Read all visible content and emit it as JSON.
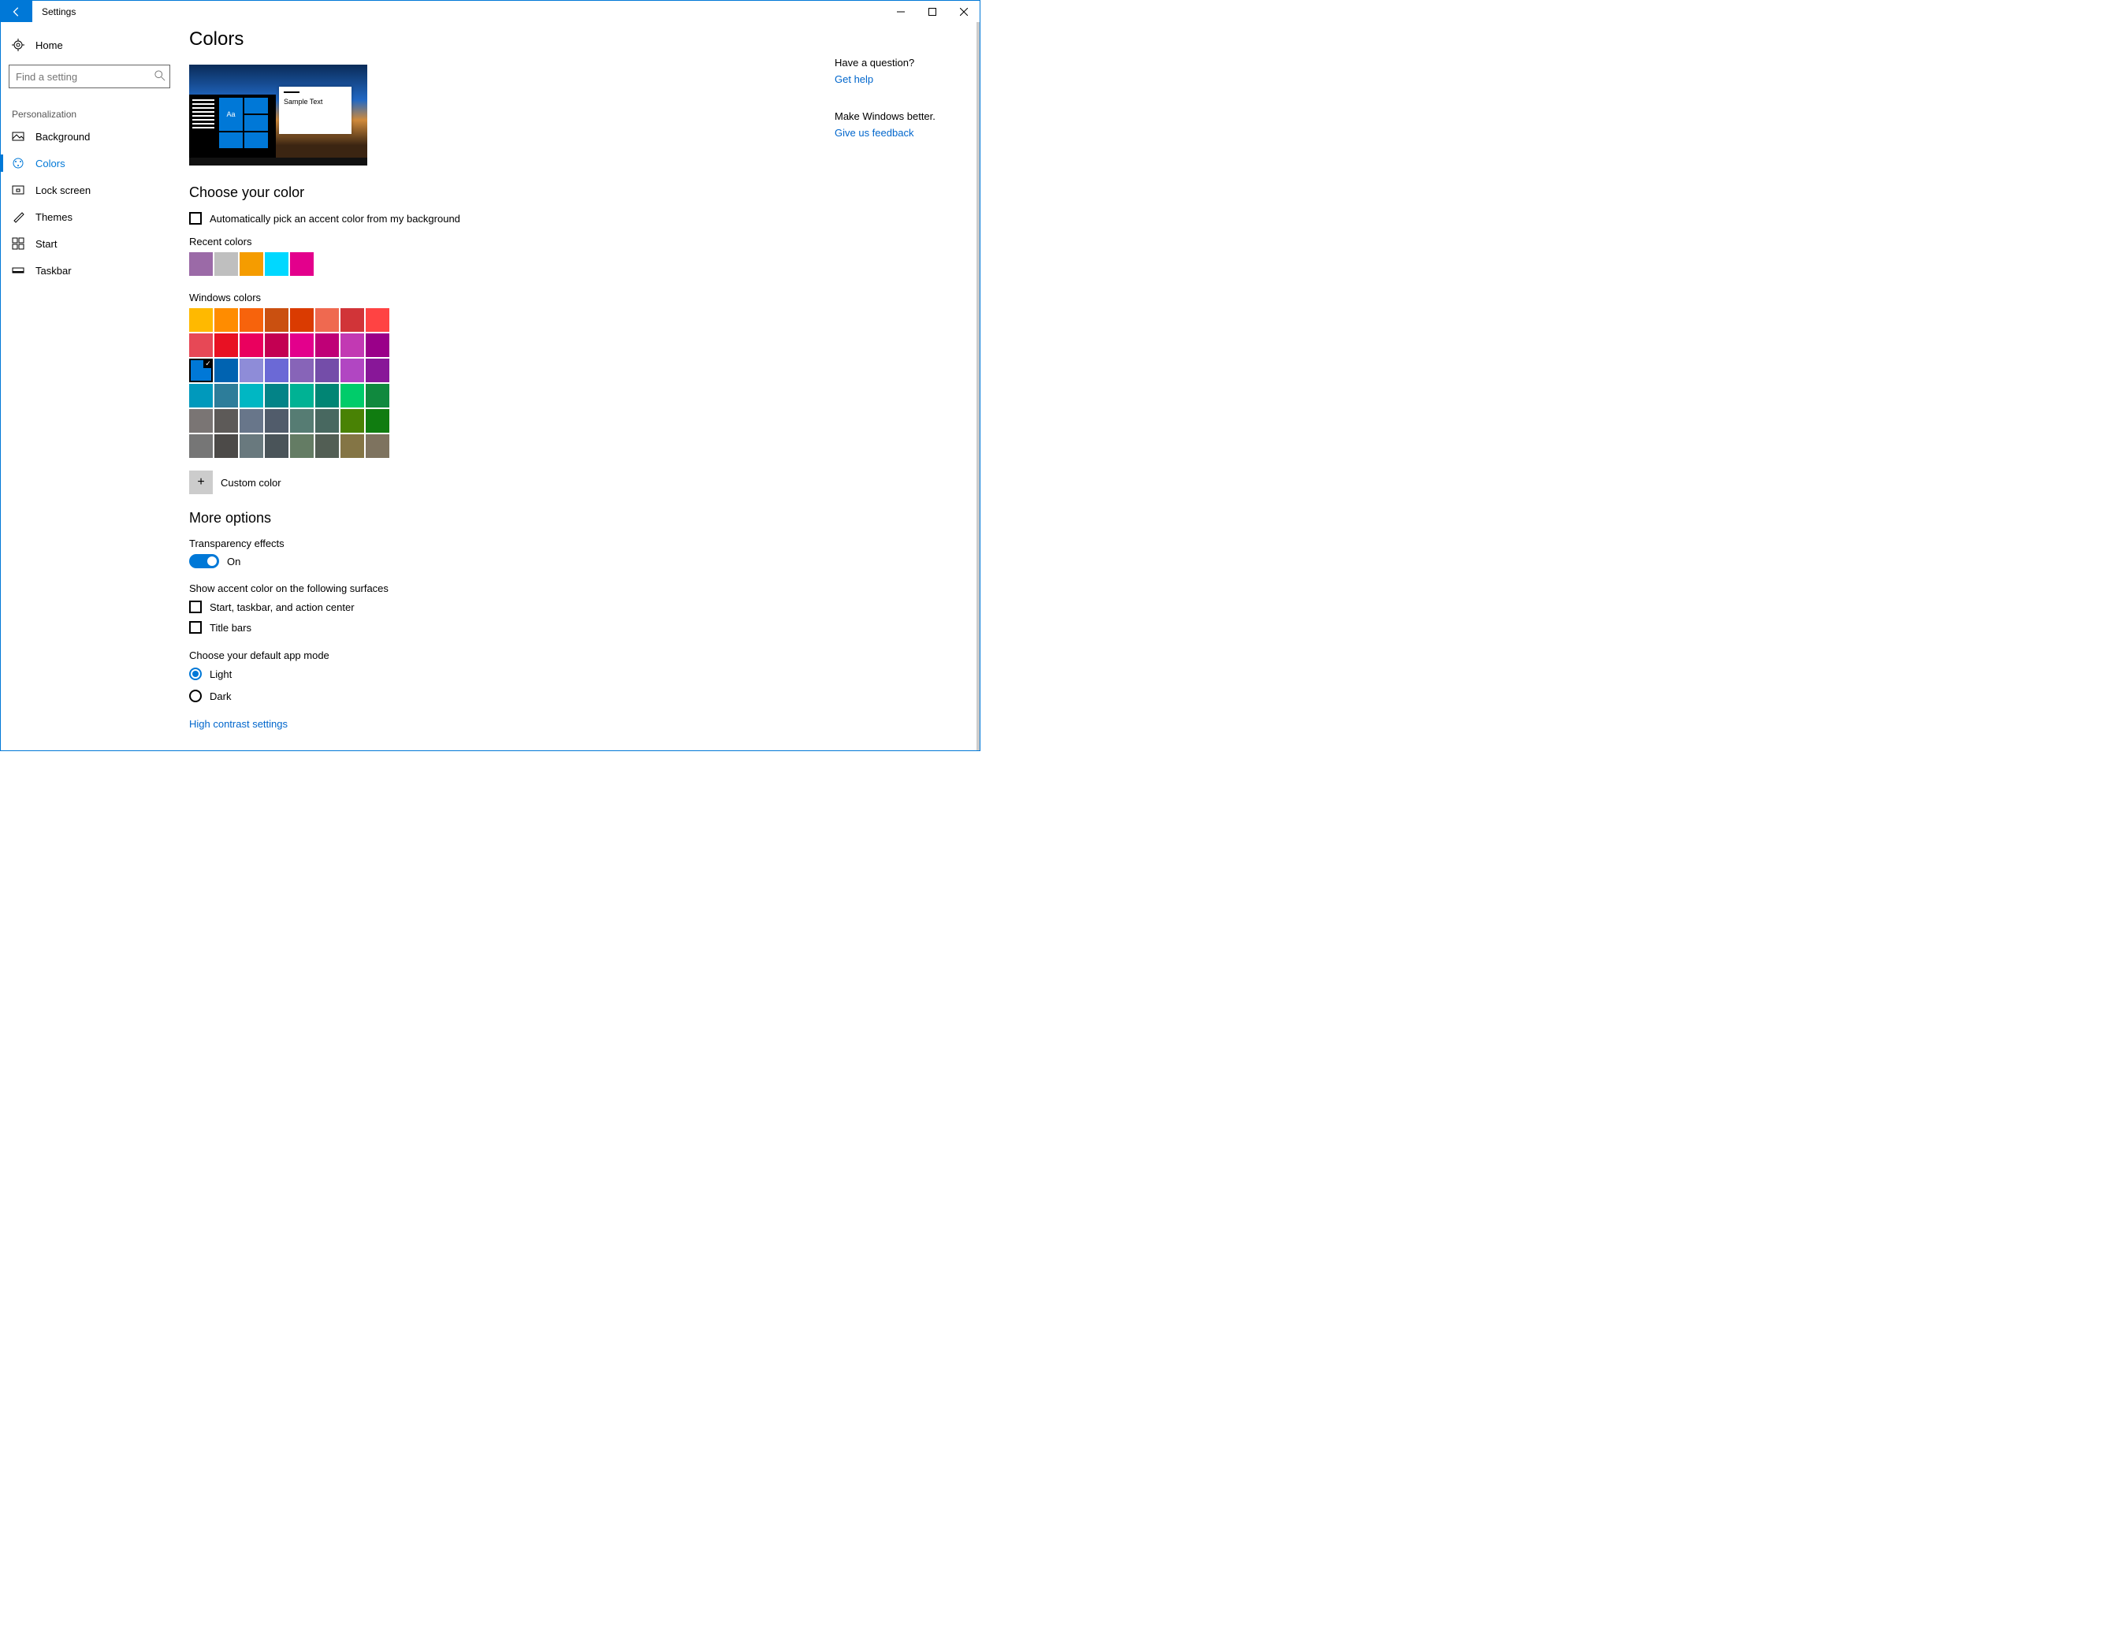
{
  "window": {
    "title": "Settings"
  },
  "sidebar": {
    "home": "Home",
    "search_placeholder": "Find a setting",
    "section": "Personalization",
    "items": [
      {
        "label": "Background"
      },
      {
        "label": "Colors"
      },
      {
        "label": "Lock screen"
      },
      {
        "label": "Themes"
      },
      {
        "label": "Start"
      },
      {
        "label": "Taskbar"
      }
    ]
  },
  "page": {
    "title": "Colors",
    "preview_sample_text": "Sample Text",
    "preview_aa": "Aa",
    "choose_color_heading": "Choose your color",
    "auto_pick_label": "Automatically pick an accent color from my background",
    "recent_colors_label": "Recent colors",
    "recent_colors": [
      "#9b6aa7",
      "#bfbfbf",
      "#f59c00",
      "#00d8ff",
      "#e3008c"
    ],
    "windows_colors_label": "Windows colors",
    "windows_colors": [
      "#ffb900",
      "#ff8c00",
      "#f7630c",
      "#ca5010",
      "#da3b01",
      "#ef6950",
      "#d13438",
      "#ff4343",
      "#e74856",
      "#e81123",
      "#ea005e",
      "#c30052",
      "#e3008c",
      "#bf0077",
      "#c239b3",
      "#9a0089",
      "#0078d7",
      "#0063b1",
      "#8e8cd8",
      "#6b69d6",
      "#8764b8",
      "#744da9",
      "#b146c2",
      "#881798",
      "#0099bc",
      "#2d7d9a",
      "#00b7c3",
      "#038387",
      "#00b294",
      "#018574",
      "#00cc6a",
      "#10893e",
      "#7a7574",
      "#5d5a58",
      "#68768a",
      "#515c6b",
      "#567c73",
      "#486860",
      "#498205",
      "#107c10",
      "#767676",
      "#4c4a48",
      "#69797e",
      "#4a5459",
      "#647c64",
      "#525e54",
      "#847545",
      "#7e735f"
    ],
    "selected_windows_color_index": 16,
    "custom_color_label": "Custom color",
    "more_options_heading": "More options",
    "transparency_label": "Transparency effects",
    "transparency_value": "On",
    "surfaces_label": "Show accent color on the following surfaces",
    "surface_start_label": "Start, taskbar, and action center",
    "surface_titlebars_label": "Title bars",
    "app_mode_heading": "Choose your default app mode",
    "app_mode_light": "Light",
    "app_mode_dark": "Dark",
    "high_contrast_link": "High contrast settings"
  },
  "right": {
    "question_heading": "Have a question?",
    "get_help": "Get help",
    "better_heading": "Make Windows better.",
    "feedback": "Give us feedback"
  }
}
